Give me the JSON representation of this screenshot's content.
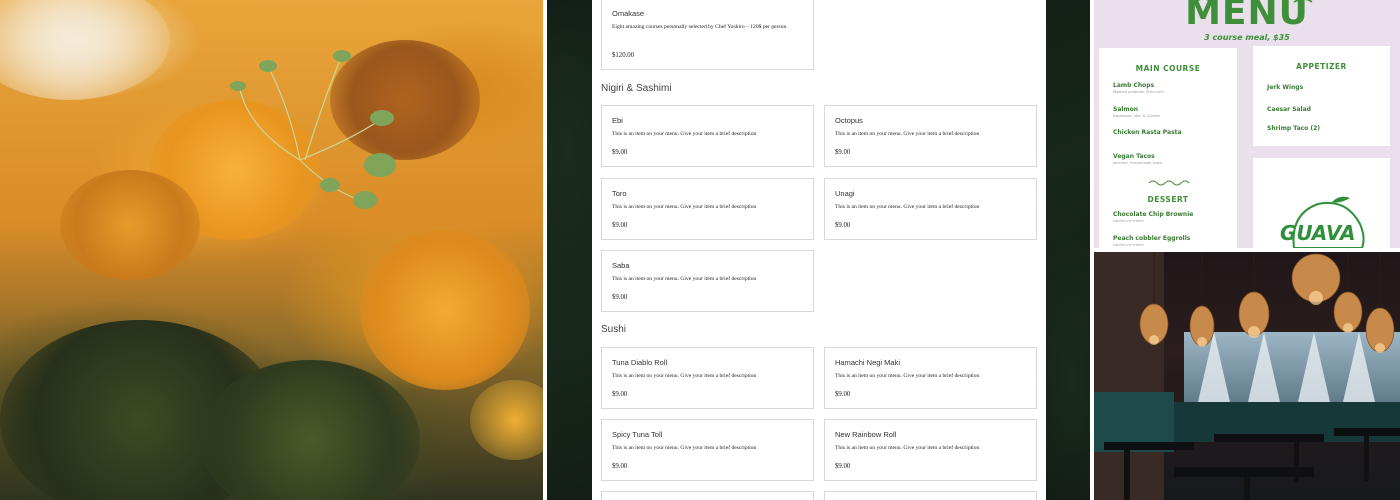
{
  "sushi_menu": {
    "top_item": {
      "name": "Omakase",
      "description": "Eight amazing courses personally selected by Chef Yoshiro – 120$ per person",
      "price": "$120.00"
    },
    "sections": [
      {
        "title": "Nigiri & Sashimi",
        "items": [
          {
            "name": "Ebi",
            "description": "This is an item on your menu. Give your item a brief description",
            "price": "$9.00"
          },
          {
            "name": "Octopus",
            "description": "This is an item on your menu. Give your item a brief description",
            "price": "$9.00"
          },
          {
            "name": "Toro",
            "description": "This is an item on your menu. Give your item a brief description",
            "price": "$9.00"
          },
          {
            "name": "Unagi",
            "description": "This is an item on your menu. Give your item a brief description",
            "price": "$9.00"
          },
          {
            "name": "Saba",
            "description": "This is an item on your menu. Give your item a brief description",
            "price": "$9.00"
          }
        ]
      },
      {
        "title": "Sushi",
        "items": [
          {
            "name": "Tuna Diablo Roll",
            "description": "This is an item on your menu. Give your item a brief description",
            "price": "$9.00"
          },
          {
            "name": "Hamachi Negi Maki",
            "description": "This is an item on your menu. Give your item a brief description",
            "price": "$9.00"
          },
          {
            "name": "Spicy Tuna Toll",
            "description": "This is an item on your menu. Give your item a brief description",
            "price": "$9.00"
          },
          {
            "name": "New Rainbow Roll",
            "description": "This is an item on your menu. Give your item a brief description",
            "price": "$9.00"
          }
        ]
      }
    ]
  },
  "flyer": {
    "title": "MENU",
    "subtitle": "3 course meal, $35",
    "main_course": {
      "heading": "MAIN COURSE",
      "items": [
        {
          "name": "Lamb Chops",
          "note": "Mashed potatoes, Broccolini"
        },
        {
          "name": "Salmon",
          "note": "Asparagus, Mac & Cheese"
        },
        {
          "name": "Chicken Rasta Pasta",
          "note": ""
        },
        {
          "name": "Vegan Tacos",
          "note": "Jackfruit, Housemade salsa"
        }
      ]
    },
    "appetizer": {
      "heading": "APPETIZER",
      "items": [
        "Jerk Wings",
        "Caesar Salad",
        "Shrimp Taco (2)"
      ]
    },
    "dessert": {
      "heading": "DESSERT",
      "items": [
        {
          "name": "Chocolate Chip Brownie",
          "note": "Vanilla ice cream"
        },
        {
          "name": "Peach cobbler Eggrolls",
          "note": "Vanilla ice cream"
        }
      ]
    },
    "logo_text": "GUAVA"
  },
  "colors": {
    "flyer_green": "#3f8f3a",
    "flyer_background": "#e9e0ec",
    "menu_card_border": "#d8d8d8"
  }
}
